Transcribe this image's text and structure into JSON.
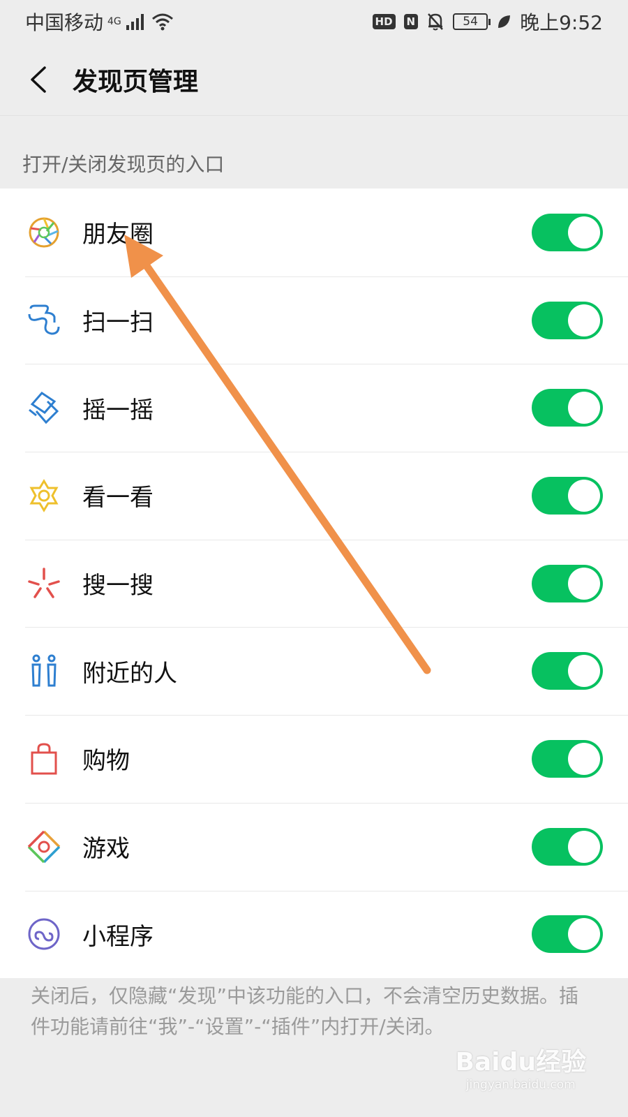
{
  "status_bar": {
    "carrier": "中国移动",
    "network": "4G",
    "hd_badge": "HD",
    "nfc_badge": "N",
    "battery": "54",
    "time": "晚上9:52"
  },
  "header": {
    "title": "发现页管理"
  },
  "section": {
    "label": "打开/关闭发现页的入口"
  },
  "items": [
    {
      "label": "朋友圈",
      "icon": "moments-icon",
      "enabled": true
    },
    {
      "label": "扫一扫",
      "icon": "scan-icon",
      "enabled": true
    },
    {
      "label": "摇一摇",
      "icon": "shake-icon",
      "enabled": true
    },
    {
      "label": "看一看",
      "icon": "top-stories-icon",
      "enabled": true
    },
    {
      "label": "搜一搜",
      "icon": "search-icon",
      "enabled": true
    },
    {
      "label": "附近的人",
      "icon": "people-nearby-icon",
      "enabled": true
    },
    {
      "label": "购物",
      "icon": "shopping-bag-icon",
      "enabled": true
    },
    {
      "label": "游戏",
      "icon": "games-icon",
      "enabled": true
    },
    {
      "label": "小程序",
      "icon": "mini-programs-icon",
      "enabled": true
    }
  ],
  "footnote": "关闭后，仅隐藏“发现”中该功能的入口，不会清空历史数据。插件功能请前往“我”-“设置”-“插件”内打开/关闭。",
  "watermark": {
    "main": "Baidu经验",
    "sub": "jingyan.baidu.com"
  },
  "colors": {
    "toggle_on": "#07c160",
    "annotation_arrow": "#f0914a"
  }
}
